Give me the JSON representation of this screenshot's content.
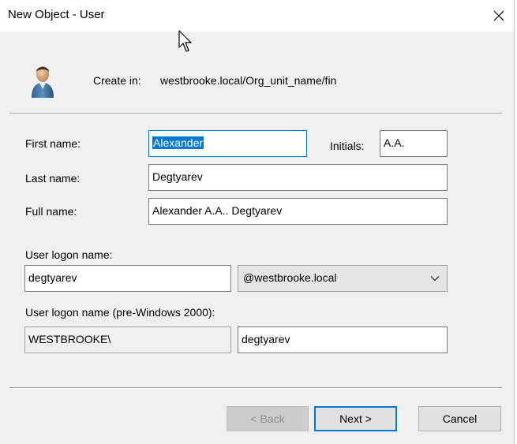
{
  "window": {
    "title": "New Object - User"
  },
  "header": {
    "create_in_label": "Create in:",
    "create_in_path": "westbrooke.local/Org_unit_name/fin"
  },
  "form": {
    "first_name_label": "First name:",
    "first_name_value": "Alexander",
    "initials_label": "Initials:",
    "initials_value": "A.A.",
    "last_name_label": "Last name:",
    "last_name_value": "Degtyarev",
    "full_name_label": "Full name:",
    "full_name_value": "Alexander A.A.. Degtyarev",
    "logon_name_label": "User logon name:",
    "logon_name_value": "degtyarev",
    "domain_suffix_value": "@westbrooke.local",
    "pre2000_label": "User logon name (pre-Windows 2000):",
    "pre2000_domain_value": "WESTBROOKE\\",
    "pre2000_name_value": "degtyarev"
  },
  "buttons": {
    "back_label": "< Back",
    "next_label": "Next >",
    "cancel_label": "Cancel"
  },
  "colors": {
    "accent": "#0078d7",
    "dialog_bg": "#f0f0f0"
  },
  "icons": {
    "close": "close-icon",
    "user": "user-icon",
    "dropdown": "chevron-down-icon",
    "cursor": "mouse-cursor-icon"
  }
}
